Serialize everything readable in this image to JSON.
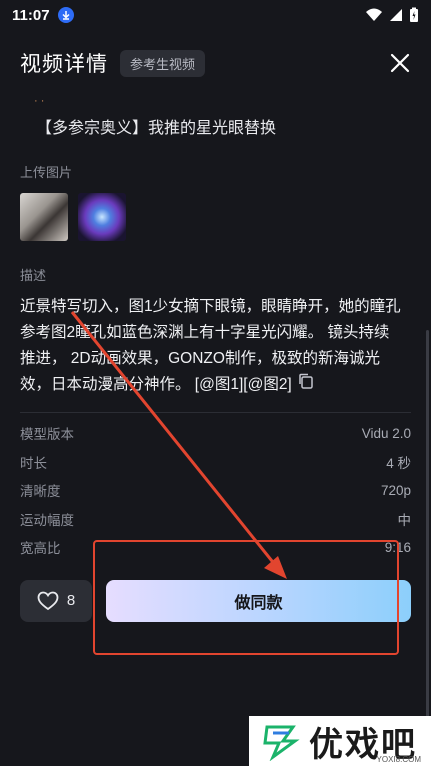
{
  "status": {
    "time": "11:07"
  },
  "header": {
    "title": "视频详情",
    "badge": "参考生视频"
  },
  "prompt_fragment": "· ·",
  "video_title": "【多参宗奥义】我推的星光眼替换",
  "upload": {
    "label": "上传图片"
  },
  "description": {
    "label": "描述",
    "text": "近景特写切入，图1少女摘下眼镜，眼睛睁开，她的瞳孔参考图2瞳孔如蓝色深渊上有十字星光闪耀。 镜头持续推进， 2D动画效果，GONZO制作，极致的新海诚光效，日本动漫高分神作。 [@图1][@图2]"
  },
  "meta": [
    {
      "key": "模型版本",
      "value": "Vidu 2.0"
    },
    {
      "key": "时长",
      "value": "4 秒"
    },
    {
      "key": "清晰度",
      "value": "720p"
    },
    {
      "key": "运动幅度",
      "value": "中"
    },
    {
      "key": "宽高比",
      "value": "9:16"
    }
  ],
  "actions": {
    "like_count": "8",
    "same_label": "做同款"
  },
  "watermark": {
    "text": "优戏吧",
    "url": "YOXI8.COM"
  },
  "colors": {
    "accent_gradient_start": "#e6ddff",
    "accent_gradient_end": "#8ccffb",
    "annotation": "#e2452f"
  }
}
